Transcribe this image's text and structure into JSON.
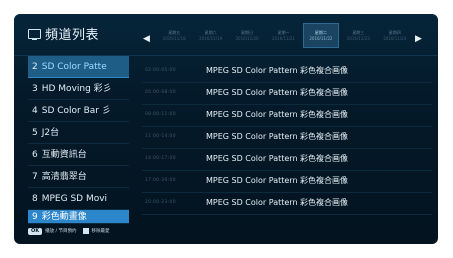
{
  "header": {
    "icon": "tv-icon",
    "title": "頻道列表",
    "left_arrow": "◀",
    "right_arrow": "▶",
    "day_tabs": [
      {
        "line1": "星期五",
        "line2": "2016/11/18",
        "active": false
      },
      {
        "line1": "星期六",
        "line2": "2016/11/19",
        "active": false
      },
      {
        "line1": "星期日",
        "line2": "2016/11/20",
        "active": false
      },
      {
        "line1": "星期一",
        "line2": "2016/11/21",
        "active": false
      },
      {
        "line1": "星期二",
        "line2": "2016/11/22",
        "active": true
      },
      {
        "line1": "星期三",
        "line2": "2016/11/23",
        "active": false
      },
      {
        "line1": "星期四",
        "line2": "2016/11/24",
        "active": false
      }
    ]
  },
  "channels": [
    {
      "num": "2",
      "name": "SD Color Patte",
      "state": "focused"
    },
    {
      "num": "3",
      "name": "HD Moving 彩彡",
      "state": ""
    },
    {
      "num": "4",
      "name": "SD Color Bar 彡",
      "state": ""
    },
    {
      "num": "5",
      "name": "J2台",
      "state": ""
    },
    {
      "num": "6",
      "name": "互動資訊台",
      "state": ""
    },
    {
      "num": "7",
      "name": "高清翡翠台",
      "state": ""
    },
    {
      "num": "8",
      "name": "MPEG SD Movi",
      "state": ""
    },
    {
      "num": "9",
      "name": "彩色動畫像",
      "state": "selected"
    }
  ],
  "programs": [
    {
      "time": "02:00-05:00",
      "title": "MPEG SD Color Pattern 彩色複合画像"
    },
    {
      "time": "05:00-08:00",
      "title": "MPEG SD Color Pattern 彩色複合画像"
    },
    {
      "time": "08:00-11:00",
      "title": "MPEG SD Color Pattern 彩色複合画像"
    },
    {
      "time": "11:00-14:00",
      "title": "MPEG SD Color Pattern 彩色複合画像"
    },
    {
      "time": "14:00-17:00",
      "title": "MPEG SD Color Pattern 彩色複合画像"
    },
    {
      "time": "17:00-20:00",
      "title": "MPEG SD Color Pattern 彩色複合画像"
    },
    {
      "time": "20:00-23:00",
      "title": "MPEG SD Color Pattern 彩色複合画像"
    }
  ],
  "footer": {
    "ok_label": "OK",
    "ok_hint": "播放 / 节目預约",
    "fav_hint": "移除最愛"
  },
  "colors": {
    "background": "#041a2a",
    "selected": "#2b86cc",
    "focused": "#1d5d86"
  }
}
